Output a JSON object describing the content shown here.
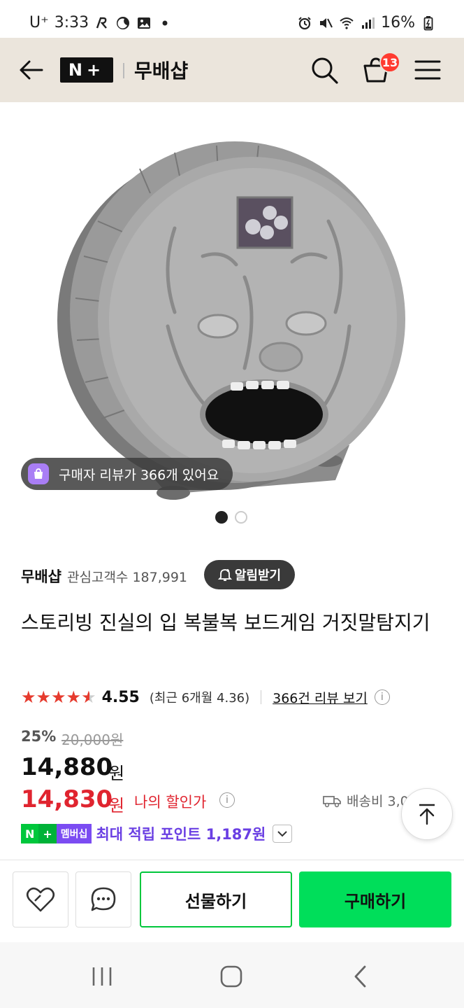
{
  "status_bar": {
    "carrier": "U⁺",
    "time": "3:33",
    "battery": "16%"
  },
  "header": {
    "logo": "N+",
    "store_name": "무배샵",
    "cart_count": "13"
  },
  "gallery": {
    "review_chip": "구매자 리뷰가 366개 있어요",
    "current_index": 1,
    "total": 2
  },
  "store": {
    "name": "무배샵",
    "followers": "관심고객수 187,991",
    "alarm_label": "알림받기"
  },
  "product": {
    "title": "스토리빙 진실의 입 복불복 보드게임 거짓말탐지기",
    "rating": {
      "stars_value": 4.55,
      "value": "4.55",
      "recent": "(최근 6개월 4.36)",
      "review_link": "366건 리뷰 보기"
    },
    "discount": "25%",
    "original_price": "20,000원",
    "price": "14,880",
    "price_unit": "원",
    "my_price": "14,830",
    "my_price_unit": "원",
    "my_price_label": "나의 할인가",
    "shipping": "배송비 3,0"
  },
  "membership": {
    "badge_n": "N",
    "badge_plus": "+",
    "badge_label": "멤버십",
    "point_text": "최대 적립 포인트 1,187원"
  },
  "actions": {
    "gift_label": "선물하기",
    "buy_label": "구매하기"
  },
  "colors": {
    "header_bg": "#ebe5dc",
    "accent_green": "#00de5a",
    "price_red": "#e0242f",
    "membership_purple": "#6a3fe3"
  }
}
